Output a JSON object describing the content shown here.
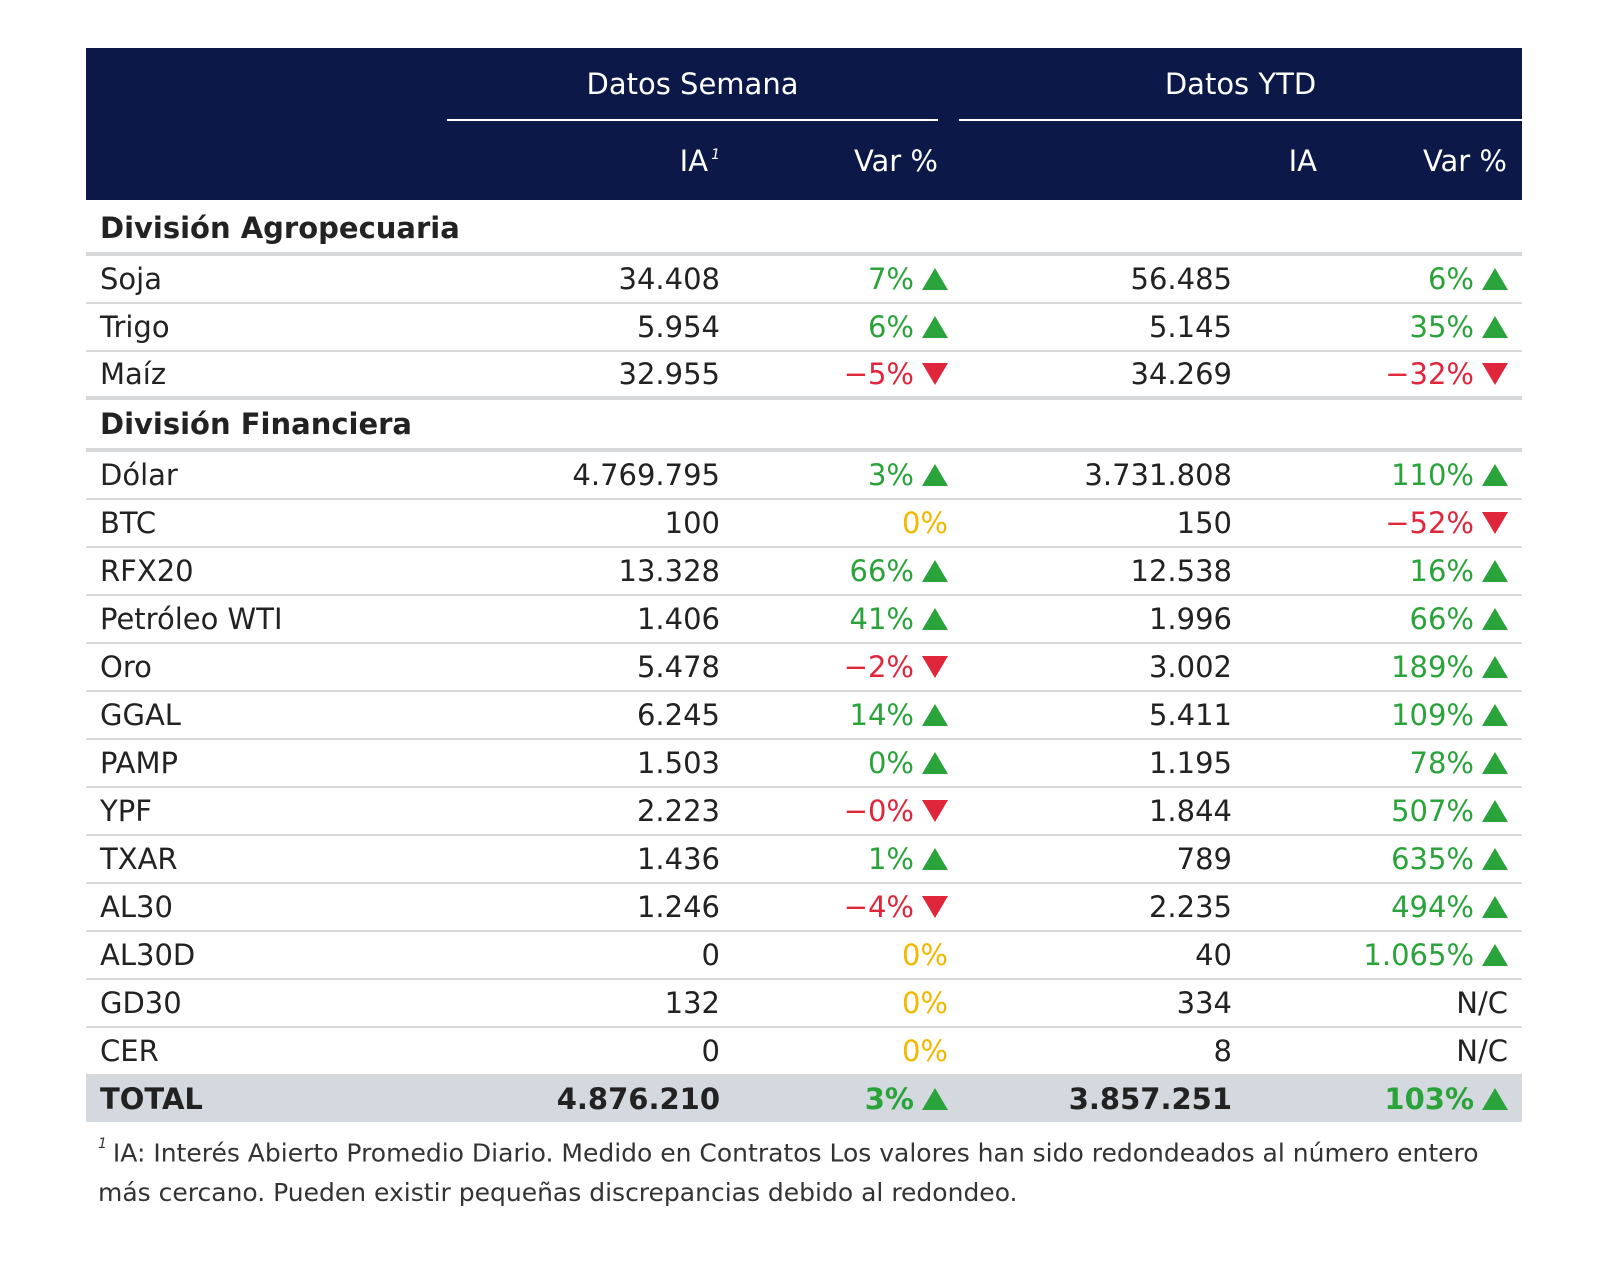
{
  "header": {
    "group_week": "Datos Semana",
    "group_ytd": "Datos YTD",
    "col_ia": "IA",
    "col_ia_sup": "1",
    "col_var": "Var %",
    "col_ia_ytd": "IA",
    "col_var_ytd": "Var %"
  },
  "colors": {
    "header_bg": "#0b1848",
    "up": "#2aa33a",
    "down": "#e0263a",
    "neutral": "#f3b800",
    "total_bg": "#d3d9de"
  },
  "sections": [
    {
      "title": "División Agropecuaria",
      "rows": [
        {
          "name": "Soja",
          "ia_week": "34.408",
          "var_week": "7%",
          "dir_week": "up",
          "ia_ytd": "56.485",
          "var_ytd": "6%",
          "dir_ytd": "up"
        },
        {
          "name": "Trigo",
          "ia_week": "5.954",
          "var_week": "6%",
          "dir_week": "up",
          "ia_ytd": "5.145",
          "var_ytd": "35%",
          "dir_ytd": "up"
        },
        {
          "name": "Maíz",
          "ia_week": "32.955",
          "var_week": "−5%",
          "dir_week": "down",
          "ia_ytd": "34.269",
          "var_ytd": "−32%",
          "dir_ytd": "down"
        }
      ]
    },
    {
      "title": "División Financiera",
      "rows": [
        {
          "name": "Dólar",
          "ia_week": "4.769.795",
          "var_week": "3%",
          "dir_week": "up",
          "ia_ytd": "3.731.808",
          "var_ytd": "110%",
          "dir_ytd": "up"
        },
        {
          "name": "BTC",
          "ia_week": "100",
          "var_week": "0%",
          "dir_week": "neutral",
          "ia_ytd": "150",
          "var_ytd": "−52%",
          "dir_ytd": "down"
        },
        {
          "name": "RFX20",
          "ia_week": "13.328",
          "var_week": "66%",
          "dir_week": "up",
          "ia_ytd": "12.538",
          "var_ytd": "16%",
          "dir_ytd": "up"
        },
        {
          "name": "Petróleo WTI",
          "ia_week": "1.406",
          "var_week": "41%",
          "dir_week": "up",
          "ia_ytd": "1.996",
          "var_ytd": "66%",
          "dir_ytd": "up"
        },
        {
          "name": "Oro",
          "ia_week": "5.478",
          "var_week": "−2%",
          "dir_week": "down",
          "ia_ytd": "3.002",
          "var_ytd": "189%",
          "dir_ytd": "up"
        },
        {
          "name": "GGAL",
          "ia_week": "6.245",
          "var_week": "14%",
          "dir_week": "up",
          "ia_ytd": "5.411",
          "var_ytd": "109%",
          "dir_ytd": "up"
        },
        {
          "name": "PAMP",
          "ia_week": "1.503",
          "var_week": "0%",
          "dir_week": "up",
          "ia_ytd": "1.195",
          "var_ytd": "78%",
          "dir_ytd": "up"
        },
        {
          "name": "YPF",
          "ia_week": "2.223",
          "var_week": "−0%",
          "dir_week": "down",
          "ia_ytd": "1.844",
          "var_ytd": "507%",
          "dir_ytd": "up"
        },
        {
          "name": "TXAR",
          "ia_week": "1.436",
          "var_week": "1%",
          "dir_week": "up",
          "ia_ytd": "789",
          "var_ytd": "635%",
          "dir_ytd": "up"
        },
        {
          "name": "AL30",
          "ia_week": "1.246",
          "var_week": "−4%",
          "dir_week": "down",
          "ia_ytd": "2.235",
          "var_ytd": "494%",
          "dir_ytd": "up"
        },
        {
          "name": "AL30D",
          "ia_week": "0",
          "var_week": "0%",
          "dir_week": "neutral",
          "ia_ytd": "40",
          "var_ytd": "1.065%",
          "dir_ytd": "up"
        },
        {
          "name": "GD30",
          "ia_week": "132",
          "var_week": "0%",
          "dir_week": "neutral",
          "ia_ytd": "334",
          "var_ytd": "N/C",
          "dir_ytd": "na"
        },
        {
          "name": "CER",
          "ia_week": "0",
          "var_week": "0%",
          "dir_week": "neutral",
          "ia_ytd": "8",
          "var_ytd": "N/C",
          "dir_ytd": "na"
        }
      ]
    }
  ],
  "total": {
    "name": "TOTAL",
    "ia_week": "4.876.210",
    "var_week": "3%",
    "dir_week": "up",
    "ia_ytd": "3.857.251",
    "var_ytd": "103%",
    "dir_ytd": "up"
  },
  "footnote": {
    "marker": "1",
    "text": "IA: Interés Abierto Promedio Diario. Medido en Contratos Los valores han sido redondeados al número entero más cercano. Pueden existir pequeñas discrepancias debido al redondeo."
  }
}
